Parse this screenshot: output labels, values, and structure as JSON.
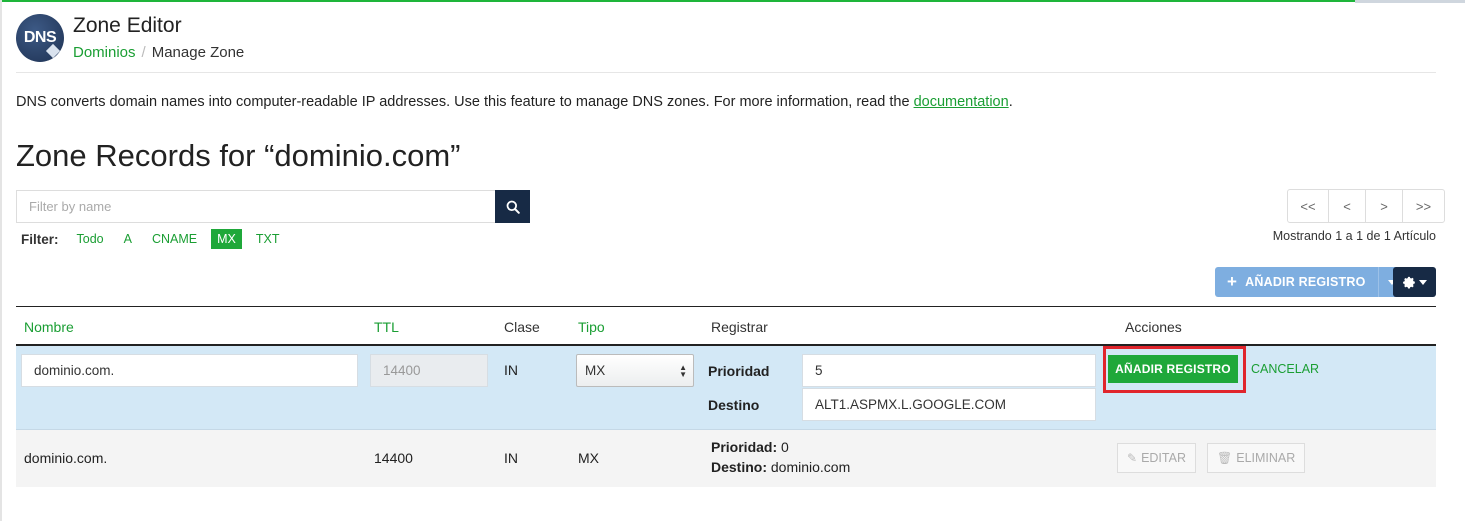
{
  "header": {
    "logo_text": "DNS",
    "title": "Zone Editor",
    "breadcrumb": {
      "link": "Dominios",
      "separator": "/",
      "current": "Manage Zone"
    }
  },
  "description": {
    "text": "DNS converts domain names into computer-readable IP addresses. Use this feature to manage DNS zones. For more information, read the ",
    "link": "documentation",
    "end": "."
  },
  "zone_title": "Zone Records for “dominio.com”",
  "search": {
    "placeholder": "Filter by name",
    "icon": "search-icon"
  },
  "filter": {
    "label": "Filter:",
    "options": [
      "Todo",
      "A",
      "CNAME",
      "MX",
      "TXT"
    ],
    "active": "MX"
  },
  "pager": {
    "first": "<<",
    "prev": "<",
    "next": ">",
    "last": ">>"
  },
  "showing": "Mostrando 1 a 1 de 1 Artículo",
  "toolbar": {
    "add_label": "AÑADIR REGISTRO",
    "settings_icon": "gear-icon"
  },
  "table": {
    "headers": {
      "name": "Nombre",
      "ttl": "TTL",
      "class": "Clase",
      "type": "Tipo",
      "record": "Registrar",
      "actions": "Acciones"
    },
    "edit_row": {
      "name": "dominio.com.",
      "ttl": "14400",
      "class": "IN",
      "type": "MX",
      "priority_label": "Prioridad",
      "priority": "5",
      "target_label": "Destino",
      "target": "ALT1.ASPMX.L.GOOGLE.COM",
      "add_button": "AÑADIR REGISTRO",
      "cancel": "CANCELAR"
    },
    "rows": [
      {
        "name": "dominio.com.",
        "ttl": "14400",
        "class": "IN",
        "type": "MX",
        "priority_label": "Prioridad:",
        "priority": "0",
        "target_label": "Destino:",
        "target": "dominio.com",
        "edit": "EDITAR",
        "delete": "ELIMINAR"
      }
    ]
  },
  "colors": {
    "accent_green": "#1fa83a",
    "navy": "#172a45",
    "edit_row_bg": "#d3e8f6",
    "highlight": "#e0252c"
  }
}
